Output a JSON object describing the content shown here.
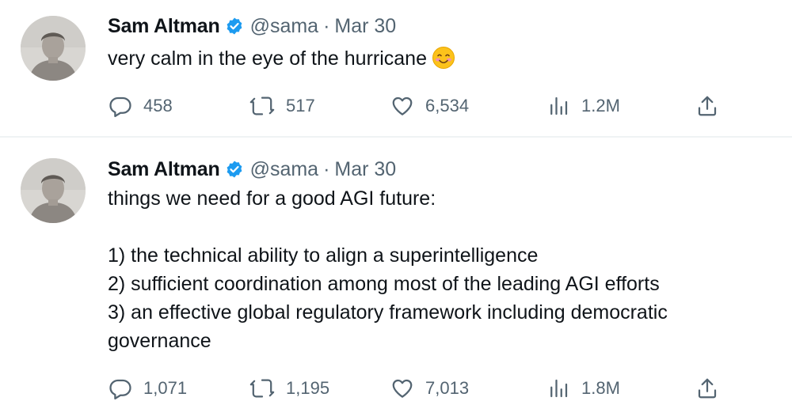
{
  "tweets": [
    {
      "author": {
        "name": "Sam Altman",
        "handle": "@sama",
        "verified": true,
        "avatar_icon": "avatar-photo"
      },
      "separator": "·",
      "date": "Mar 30",
      "text_lines": [
        "very calm in the eye of the hurricane"
      ],
      "emoji": "smiling-face-with-hearts-emoji",
      "stats": {
        "replies": "458",
        "retweets": "517",
        "likes": "6,534",
        "views": "1.2M"
      }
    },
    {
      "author": {
        "name": "Sam Altman",
        "handle": "@sama",
        "verified": true,
        "avatar_icon": "avatar-photo"
      },
      "separator": "·",
      "date": "Mar 30",
      "text_lines": [
        "things we need for a good AGI future:",
        "",
        "1) the technical ability to align a superintelligence",
        "2) sufficient coordination among most of the leading AGI efforts",
        "3) an effective global regulatory framework including democratic",
        "governance"
      ],
      "stats": {
        "replies": "1,071",
        "retweets": "1,195",
        "likes": "7,013",
        "views": "1.8M"
      }
    }
  ],
  "icons": {
    "reply": "reply-icon",
    "retweet": "retweet-icon",
    "like": "heart-icon",
    "views": "views-bar-chart-icon",
    "share": "share-icon",
    "verified": "verified-badge-icon"
  },
  "colors": {
    "text_primary": "#0f1419",
    "text_secondary": "#536471",
    "verified_blue": "#1d9bf0",
    "divider": "#eff3f4"
  }
}
